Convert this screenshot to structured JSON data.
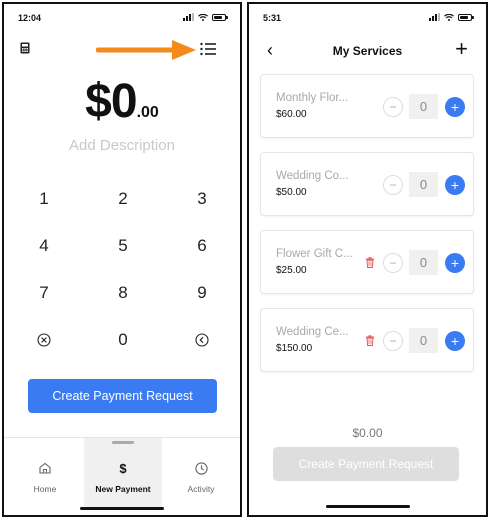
{
  "left_screen": {
    "status_time": "12:04",
    "amount": {
      "dollars": "$0",
      "cents": ".00"
    },
    "description_placeholder": "Add Description",
    "keys": [
      "1",
      "2",
      "3",
      "4",
      "5",
      "6",
      "7",
      "8",
      "9",
      "clear-icon",
      "0",
      "backspace-icon"
    ],
    "key_labels": {
      "k1": "1",
      "k2": "2",
      "k3": "3",
      "k4": "4",
      "k5": "5",
      "k6": "6",
      "k7": "7",
      "k8": "8",
      "k9": "9",
      "k0": "0"
    },
    "cta_label": "Create Payment Request",
    "tabs": [
      {
        "label": "Home",
        "icon": "home-icon"
      },
      {
        "label": "New Payment",
        "icon": "dollar-icon"
      },
      {
        "label": "Activity",
        "icon": "clock-icon"
      }
    ],
    "active_tab": "New Payment",
    "annotation_color": "#f28a1c"
  },
  "right_screen": {
    "status_time": "5:31",
    "title": "My Services",
    "services": [
      {
        "name": "Monthly Flor...",
        "price": "$60.00",
        "qty": "0",
        "show_trash": false
      },
      {
        "name": "Wedding Co...",
        "price": "$50.00",
        "qty": "0",
        "show_trash": false
      },
      {
        "name": "Flower Gift C...",
        "price": "$25.00",
        "qty": "0",
        "show_trash": true
      },
      {
        "name": "Wedding Ce...",
        "price": "$150.00",
        "qty": "0",
        "show_trash": true
      }
    ],
    "total": "$0.00",
    "cta_label": "Create Payment Request",
    "cta_enabled": false
  },
  "colors": {
    "accent": "#3a7bf2",
    "disabled": "#dedede",
    "trash": "#e55a5a"
  }
}
